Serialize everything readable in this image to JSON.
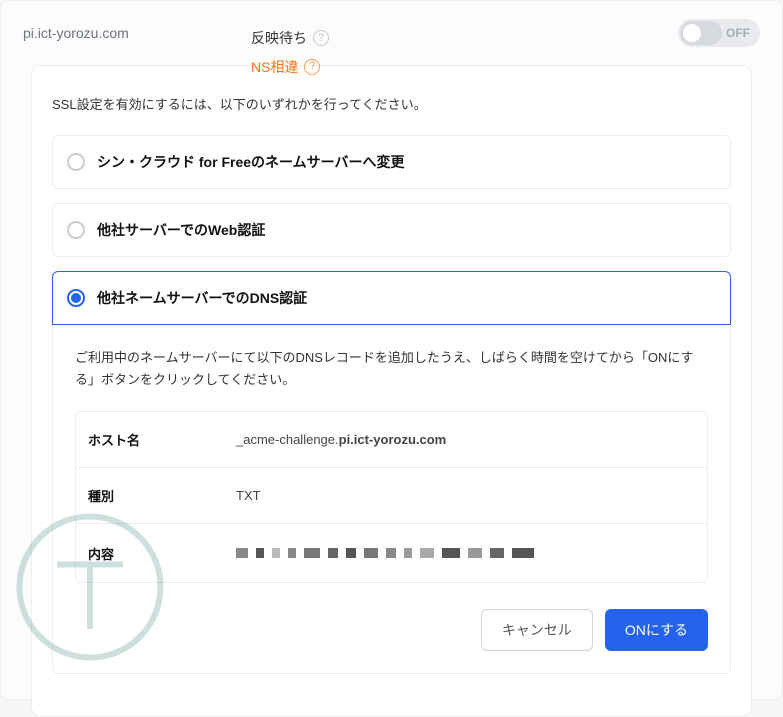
{
  "header": {
    "domain": "pi.ict-yorozu.com",
    "status_pending": "反映待ち",
    "status_ns": "NS相違",
    "toggle_label": "OFF"
  },
  "panel": {
    "instruction": "SSL設定を有効にするには、以下のいずれかを行ってください。",
    "options": [
      {
        "label": "シン・クラウド for Freeのネームサーバーへ変更"
      },
      {
        "label": "他社サーバーでのWeb認証"
      },
      {
        "label": "他社ネームサーバーでのDNS認証"
      }
    ],
    "expanded": {
      "text": "ご利用中のネームサーバーにて以下のDNSレコードを追加したうえ、しばらく時間を空けてから「ONにする」ボタンをクリックしてください。",
      "rows": {
        "host_label": "ホスト名",
        "host_prefix": "_acme-challenge.",
        "host_bold": "pi.ict-yorozu.com",
        "type_label": "種別",
        "type_value": "TXT",
        "content_label": "内容"
      }
    },
    "buttons": {
      "cancel": "キャンセル",
      "submit": "ONにする"
    }
  }
}
